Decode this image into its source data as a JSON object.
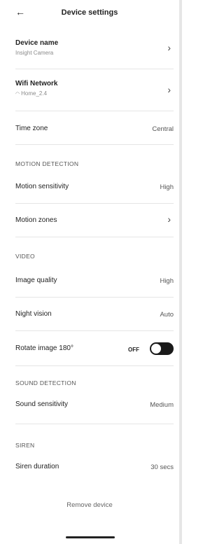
{
  "header": {
    "back_icon": "arrow-left-icon",
    "title": "Device settings"
  },
  "device": {
    "label": "Device name",
    "value": "Insight Camera"
  },
  "wifi": {
    "label": "Wifi Network",
    "value": "Home_2.4"
  },
  "timezone": {
    "label": "Time zone",
    "value": "Central"
  },
  "sections": {
    "motion": "MOTION DETECTION",
    "video": "VIDEO",
    "sound": "SOUND DETECTION",
    "siren": "SIREN"
  },
  "motion": {
    "sensitivity_label": "Motion sensitivity",
    "sensitivity_value": "High",
    "zones_label": "Motion zones"
  },
  "video": {
    "quality_label": "Image quality",
    "quality_value": "High",
    "night_label": "Night vision",
    "night_value": "Auto",
    "rotate_label": "Rotate image 180°",
    "rotate_state": "OFF"
  },
  "sound": {
    "sensitivity_label": "Sound sensitivity",
    "sensitivity_value": "Medium"
  },
  "siren": {
    "duration_label": "Siren duration",
    "duration_value": "30 secs"
  },
  "actions": {
    "remove": "Remove device"
  }
}
